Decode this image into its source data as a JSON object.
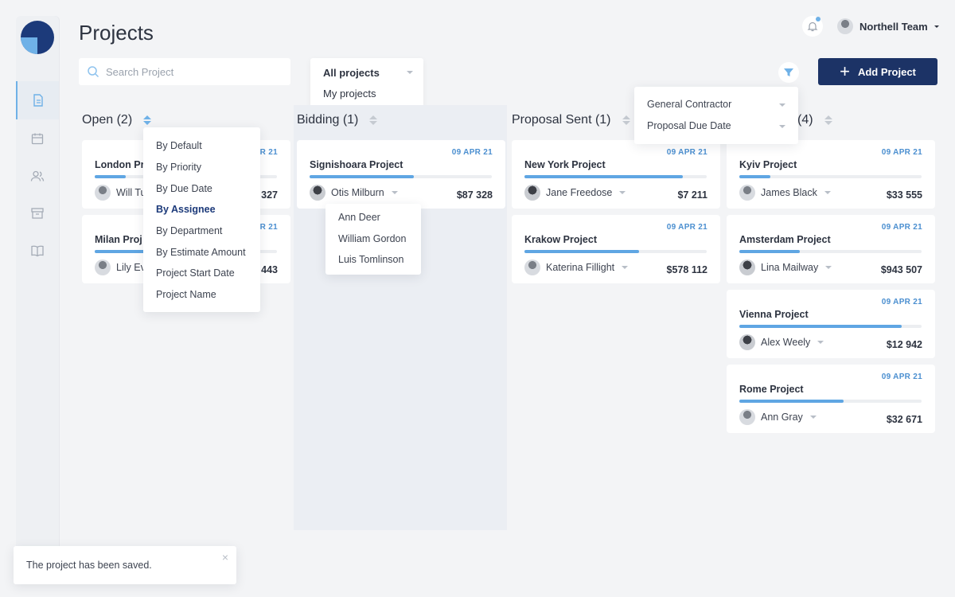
{
  "header": {
    "title": "Projects",
    "search_placeholder": "Search Project",
    "project_filter": {
      "selected": "All projects",
      "options": [
        "All projects",
        "My projects"
      ]
    },
    "add_button": "Add Project",
    "team_name": "Northell Team"
  },
  "filter_popup": {
    "items": [
      "General Contractor",
      "Proposal Due Date"
    ]
  },
  "sort_popup": {
    "items": [
      "By Default",
      "By Priority",
      "By Due Date",
      "By Assignee",
      "By Department",
      "By Estimate Amount",
      "Project Start Date",
      "Project Name"
    ],
    "selected": "By Assignee"
  },
  "assignee_popup": {
    "items": [
      "Ann Deer",
      "William Gordon",
      "Luis Tomlinson"
    ]
  },
  "columns": [
    {
      "title": "Open (2)",
      "cards": [
        {
          "date": "PR 21",
          "name": "London Pr",
          "person": "Will Tu",
          "amount": "327",
          "progress": 0.17
        },
        {
          "date": "PR 21",
          "name": "Milan Proj",
          "person": "Lily Ev",
          "amount": "443",
          "progress": 0.31
        }
      ]
    },
    {
      "title": "Bidding (1)",
      "cards": [
        {
          "date": "09 APR 21",
          "name": "Signishoara Project",
          "person": "Otis Milburn",
          "amount": "$87 328",
          "progress": 0.57
        }
      ]
    },
    {
      "title": "Proposal Sent (1)",
      "cards": [
        {
          "date": "09 APR 21",
          "name": "New York Project",
          "person": "Jane Freedose",
          "amount": "$7 211",
          "progress": 0.87
        },
        {
          "date": "09 APR 21",
          "name": "Krakow Project",
          "person": "Katerina Fillight",
          "amount": "$578 112",
          "progress": 0.63
        }
      ]
    },
    {
      "title": "(4)",
      "cards": [
        {
          "date": "09 APR 21",
          "name": "Kyiv Project",
          "person": "James Black",
          "amount": "$33 555",
          "progress": 0.17
        },
        {
          "date": "09 APR 21",
          "name": "Amsterdam Project",
          "person": "Lina Mailway",
          "amount": "$943 507",
          "progress": 0.33
        },
        {
          "date": "09 APR 21",
          "name": "Vienna Project",
          "person": "Alex Weely",
          "amount": "$12 942",
          "progress": 0.89
        },
        {
          "date": "09 APR 21",
          "name": "Rome Project",
          "person": "Ann Gray",
          "amount": "$32 671",
          "progress": 0.57
        }
      ]
    }
  ],
  "toast": {
    "message": "The project has been saved.",
    "close": "×"
  },
  "colors": {
    "accent": "#6fb1e7",
    "primary": "#1c3366",
    "date": "#4b8fd0"
  }
}
